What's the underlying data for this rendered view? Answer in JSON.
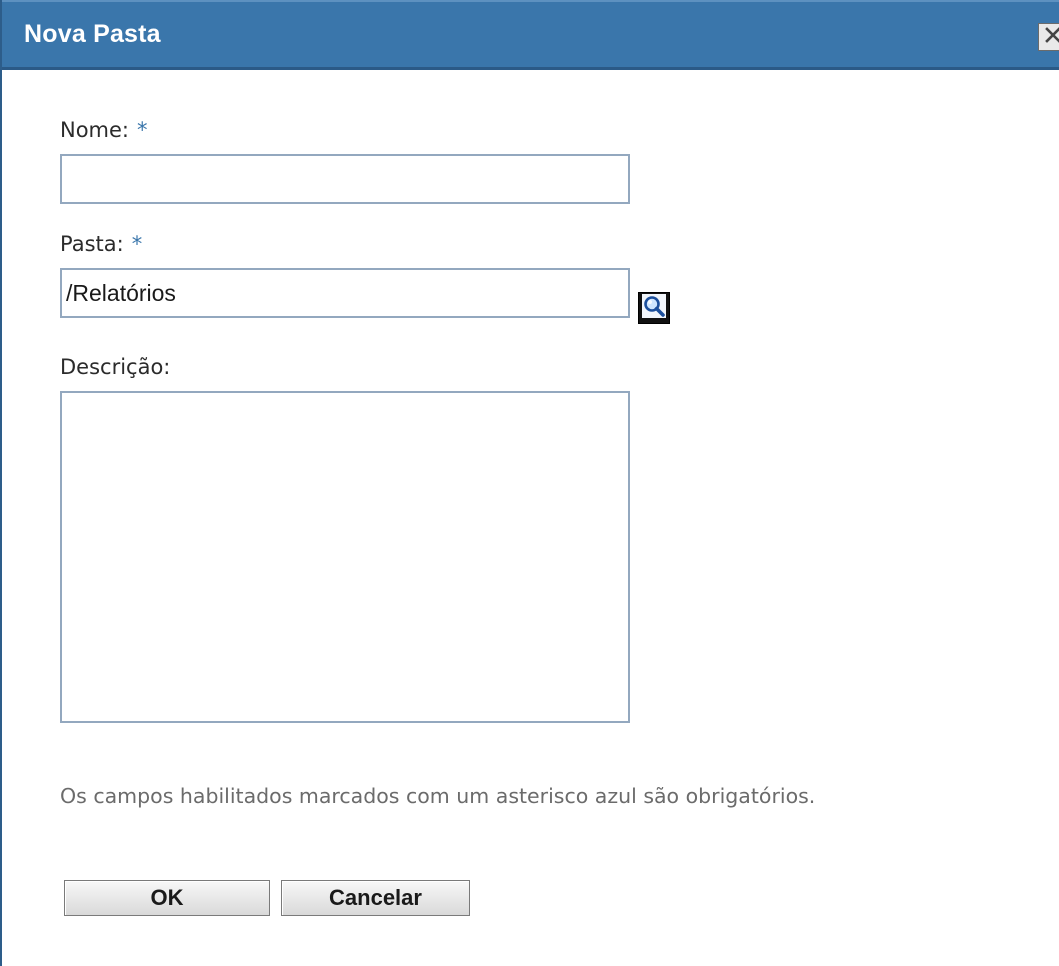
{
  "dialog": {
    "title": "Nova Pasta",
    "close_icon": "close-icon"
  },
  "form": {
    "nome": {
      "label": "Nome:",
      "required_marker": "*",
      "value": ""
    },
    "pasta": {
      "label": "Pasta:",
      "required_marker": "*",
      "value": "/Relatórios",
      "browse_icon": "magnifier-icon"
    },
    "descricao": {
      "label": "Descrição:",
      "value": ""
    }
  },
  "note": "Os campos habilitados marcados com um asterisco azul são obrigatórios.",
  "buttons": {
    "ok": "OK",
    "cancel": "Cancelar"
  },
  "colors": {
    "titlebar": "#3a76ab",
    "required_asterisk": "#3a76ab",
    "field_border": "#93a8bf",
    "note_text": "#6b6b6b"
  }
}
